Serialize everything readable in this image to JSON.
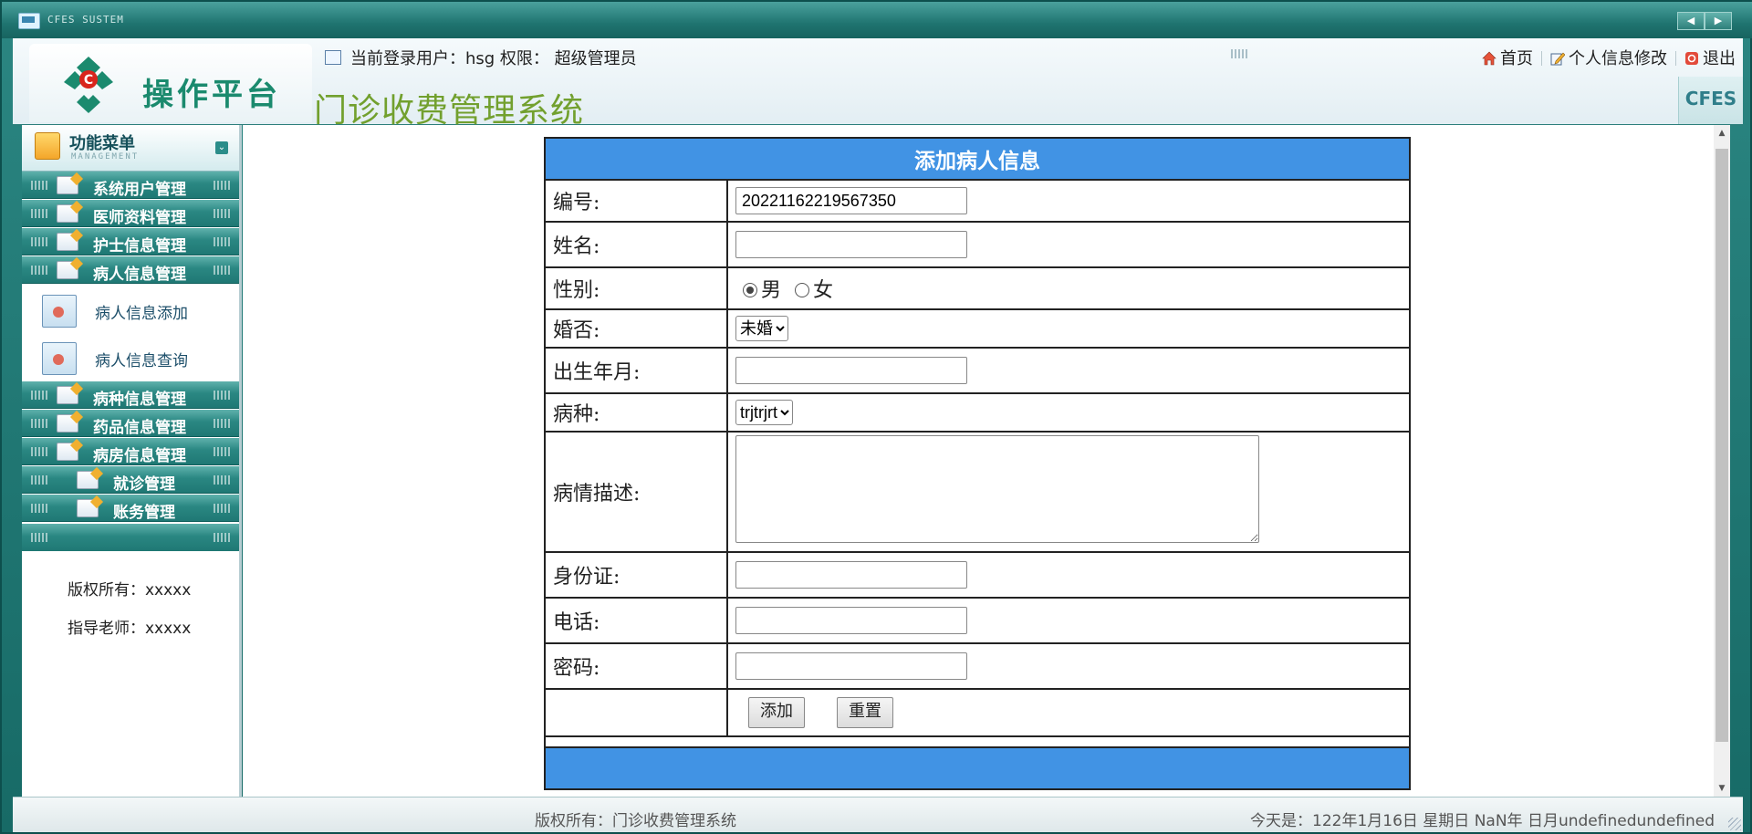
{
  "window": {
    "title": "CFES SUSTEM"
  },
  "header": {
    "logo_text": "操作平台",
    "system_title": "门诊收费管理系统",
    "user_info": "当前登录用户：hsg 权限： 超级管理员",
    "links": {
      "home": "首页",
      "profile": "个人信息修改",
      "logout": "退出"
    },
    "brand": "CFES"
  },
  "sidebar": {
    "title": "功能菜单",
    "subtitle": "MANAGEMENT",
    "menu": [
      "系统用户管理",
      "医师资料管理",
      "护士信息管理",
      "病人信息管理",
      "病种信息管理",
      "药品信息管理",
      "病房信息管理",
      "就诊管理",
      "账务管理"
    ],
    "submenu": [
      "病人信息添加",
      "病人信息查询"
    ],
    "copyright": "版权所有：xxxxx",
    "teacher": "指导老师：xxxxx"
  },
  "form": {
    "title": "添加病人信息",
    "labels": {
      "id": "编号:",
      "name": "姓名:",
      "gender": "性别:",
      "marital": "婚否:",
      "birth": "出生年月:",
      "disease": "病种:",
      "description": "病情描述:",
      "idcard": "身份证:",
      "phone": "电话:",
      "password": "密码:"
    },
    "values": {
      "id": "20221162219567350",
      "name": "",
      "birth": "",
      "idcard": "",
      "phone": "",
      "password": ""
    },
    "gender_options": [
      "男",
      "女"
    ],
    "gender_selected": "男",
    "marital_selected": "未婚",
    "disease_selected": "trjtrjrt",
    "buttons": {
      "add": "添加",
      "reset": "重置"
    }
  },
  "statusbar": {
    "copyright": "版权所有：门诊收费管理系统",
    "date": "今天是：122年1月16日 星期日 NaN年 日月undefinedundefined"
  },
  "colors": {
    "accent": "#4193e4",
    "teal": "#2a8782",
    "title_green": "#72a02e"
  }
}
